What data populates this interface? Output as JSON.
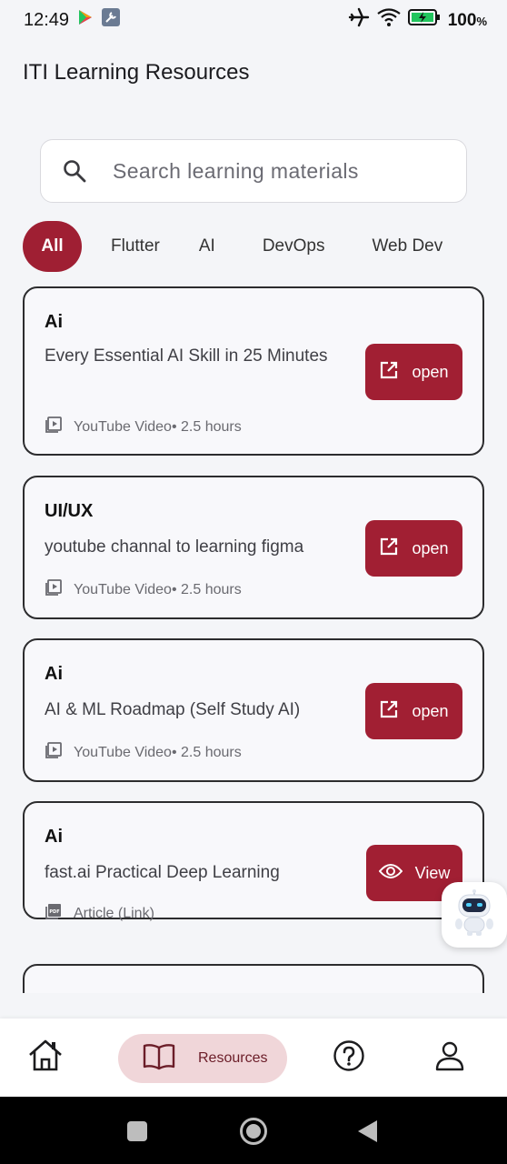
{
  "status_bar": {
    "time": "12:49",
    "battery": "100",
    "battery_unit": "%"
  },
  "header": {
    "title": "ITI Learning Resources"
  },
  "search": {
    "placeholder": "Search learning materials"
  },
  "filters": [
    {
      "label": "All",
      "active": true
    },
    {
      "label": "Flutter",
      "active": false
    },
    {
      "label": "AI",
      "active": false
    },
    {
      "label": "DevOps",
      "active": false
    },
    {
      "label": "Web Dev",
      "active": false
    }
  ],
  "resources": [
    {
      "category": "Ai",
      "title": "Every Essential AI Skill in 25 Minutes",
      "type": "YouTube Video",
      "duration": "• 2.5 hours",
      "type_icon": "video-icon",
      "action": "open"
    },
    {
      "category": "UI/UX",
      "title": "youtube channal to learning figma",
      "type": "YouTube Video",
      "duration": "• 2.5 hours",
      "type_icon": "video-icon",
      "action": "open"
    },
    {
      "category": "Ai",
      "title": "AI & ML Roadmap (Self Study AI)",
      "type": "YouTube Video",
      "duration": "• 2.5 hours",
      "type_icon": "video-icon",
      "action": "open"
    },
    {
      "category": "Ai",
      "title": "fast.ai Practical Deep Learning",
      "type": "Article (Link)",
      "duration": "",
      "type_icon": "pdf-icon",
      "action": "View"
    }
  ],
  "bottom_nav": {
    "active_label": "Resources"
  },
  "colors": {
    "accent": "#a11f33",
    "accent_light": "#f0d6d9",
    "background": "#f4f5f8"
  }
}
